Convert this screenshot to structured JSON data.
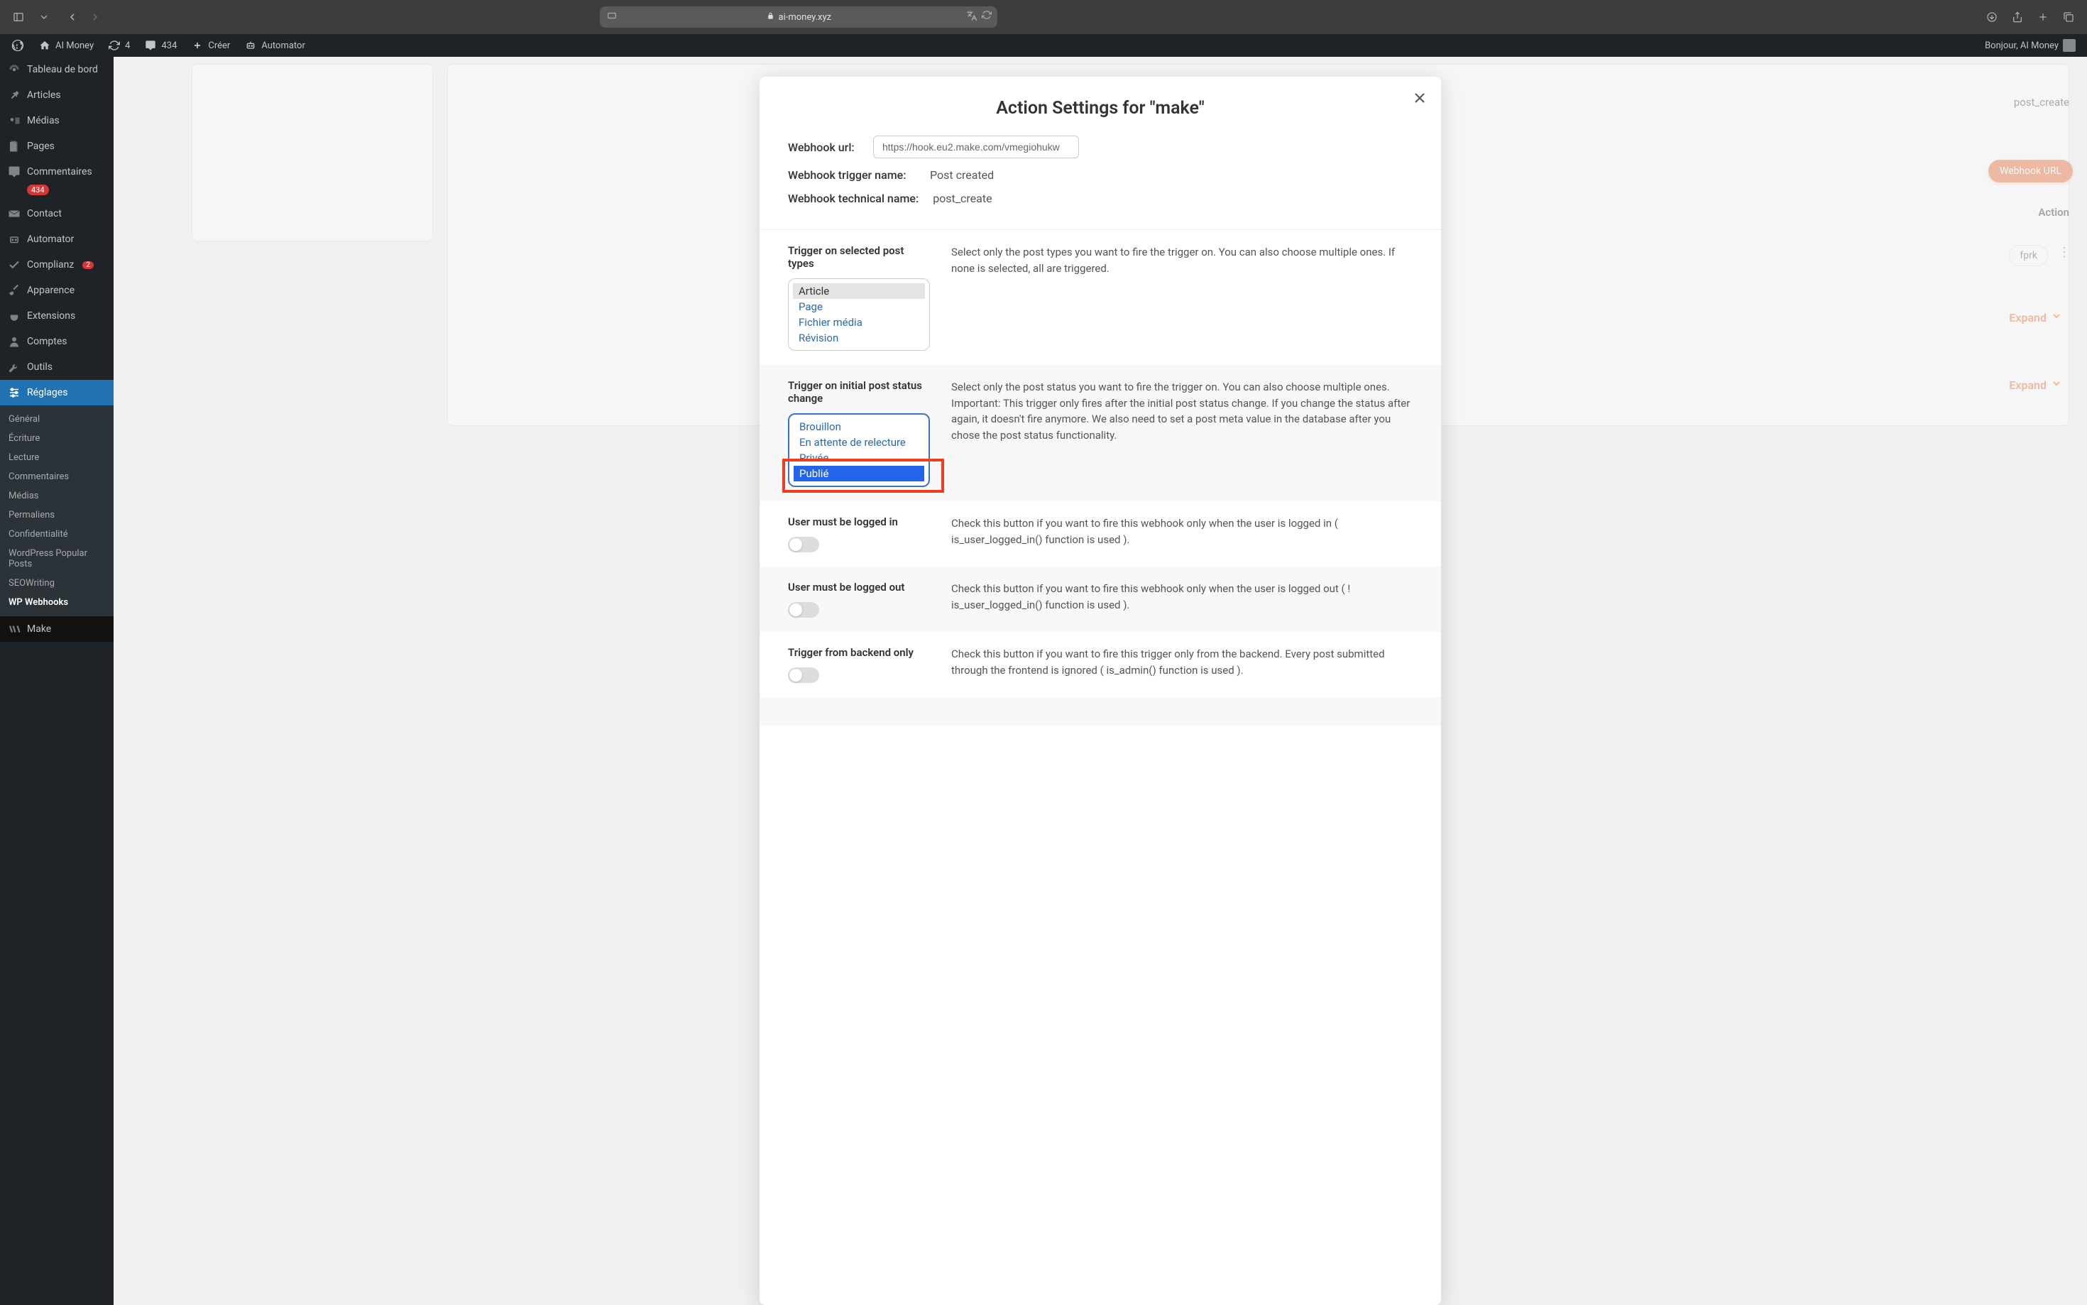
{
  "browser": {
    "url": "ai-money.xyz"
  },
  "adminbar": {
    "site_name": "AI Money",
    "refresh_count": "4",
    "comments_count": "434",
    "create": "Créer",
    "automator": "Automator",
    "greeting": "Bonjour, AI Money"
  },
  "sidebar": {
    "dashboard": "Tableau de bord",
    "articles": "Articles",
    "medias": "Médias",
    "pages": "Pages",
    "comments": "Commentaires",
    "comments_badge": "434",
    "contact": "Contact",
    "automator": "Automator",
    "complianz": "Complianz",
    "complianz_badge": "2",
    "appearance": "Apparence",
    "extensions": "Extensions",
    "accounts": "Comptes",
    "tools": "Outils",
    "settings": "Réglages",
    "submenu": {
      "general": "Général",
      "writing": "Écriture",
      "reading": "Lecture",
      "discussion": "Commentaires",
      "media": "Médias",
      "permalinks": "Permaliens",
      "privacy": "Confidentialité",
      "wpp": "WordPress Popular Posts",
      "seowriting": "SEOWriting",
      "wpwebhooks": "WP Webhooks"
    },
    "make": "Make"
  },
  "background": {
    "tag": "post_create",
    "webhook_btn": "Webhook URL",
    "action": "Action",
    "code": "fprk",
    "expand": "Expand"
  },
  "modal": {
    "title": "Action Settings for \"make\"",
    "webhook_url_label": "Webhook url:",
    "webhook_url_value": "https://hook.eu2.make.com/vmegiohukw",
    "trigger_name_label": "Webhook trigger name:",
    "trigger_name_value": "Post created",
    "technical_name_label": "Webhook technical name:",
    "technical_name_value": "post_create",
    "sections": {
      "post_types": {
        "title": "Trigger on selected post types",
        "desc": "Select only the post types you want to fire the trigger on. You can also choose multiple ones. If none is selected, all are triggered.",
        "options": [
          "Article",
          "Page",
          "Fichier média",
          "Révision"
        ]
      },
      "status_change": {
        "title": "Trigger on initial post status change",
        "desc": "Select only the post status you want to fire the trigger on. You can also choose multiple ones. Important: This trigger only fires after the initial post status change. If you change the status after again, it doesn't fire anymore. We also need to set a post meta value in the database after you chose the post status functionality.",
        "options": [
          "Brouillon",
          "En attente de relecture",
          "Privée",
          "Publié"
        ]
      },
      "logged_in": {
        "title": "User must be logged in",
        "desc": "Check this button if you want to fire this webhook only when the user is logged in ( is_user_logged_in() function is used )."
      },
      "logged_out": {
        "title": "User must be logged out",
        "desc": "Check this button if you want to fire this webhook only when the user is logged out ( ! is_user_logged_in() function is used )."
      },
      "backend": {
        "title": "Trigger from backend only",
        "desc": "Check this button if you want to fire this trigger only from the backend. Every post submitted through the frontend is ignored ( is_admin() function is used )."
      }
    }
  }
}
